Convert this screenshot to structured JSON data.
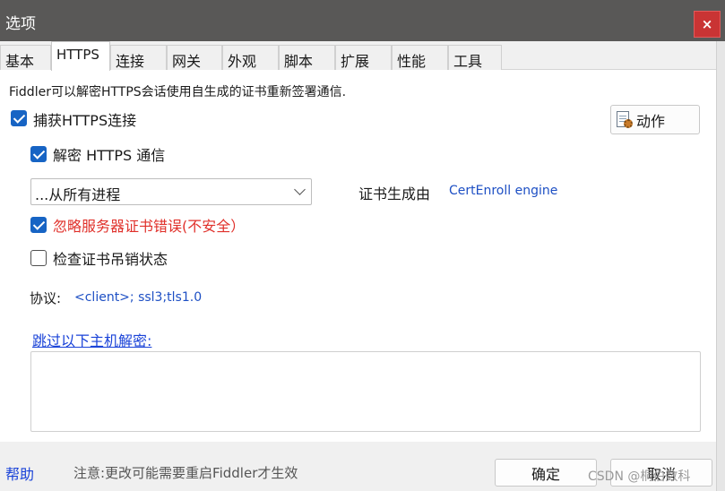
{
  "window": {
    "title": "选项",
    "close_label": "×"
  },
  "tabs": [
    {
      "label": "基本"
    },
    {
      "label": "HTTPS"
    },
    {
      "label": "连接"
    },
    {
      "label": "网关"
    },
    {
      "label": "外观"
    },
    {
      "label": "脚本"
    },
    {
      "label": "扩展"
    },
    {
      "label": "性能"
    },
    {
      "label": "工具"
    }
  ],
  "active_tab": "HTTPS",
  "https": {
    "description": "Fiddler可以解密HTTPS会话使用自生成的证书重新签署通信.",
    "capture": {
      "label": "捕获HTTPS连接",
      "checked": true
    },
    "action_button": {
      "label": "动作",
      "icon": "document-gear-icon"
    },
    "decrypt": {
      "label": "解密 HTTPS 通信",
      "checked": true
    },
    "process_select": {
      "value": "...从所有进程"
    },
    "cert_generator": {
      "label": "证书生成由",
      "value": "CertEnroll engine"
    },
    "ignore_errors": {
      "label": "忽略服务器证书错误(不安全）",
      "checked": true
    },
    "check_revocation": {
      "label": "检查证书吊销状态",
      "checked": false
    },
    "protocols": {
      "label": "协议:",
      "value": "<client>; ssl3;tls1.0"
    },
    "skip_link": "跳过以下主机解密:",
    "skip_hosts": ""
  },
  "footer": {
    "help": "帮助",
    "note": "注意:更改可能需要重启Fiddler才生效",
    "ok": "确定",
    "cancel": "取消",
    "watermark": "CSDN @桐伯数科"
  },
  "colors": {
    "titlebar": "#595857",
    "close": "#c93434",
    "checkbox": "#1764c4",
    "link": "#1a43d8",
    "warning": "#e0302a"
  }
}
